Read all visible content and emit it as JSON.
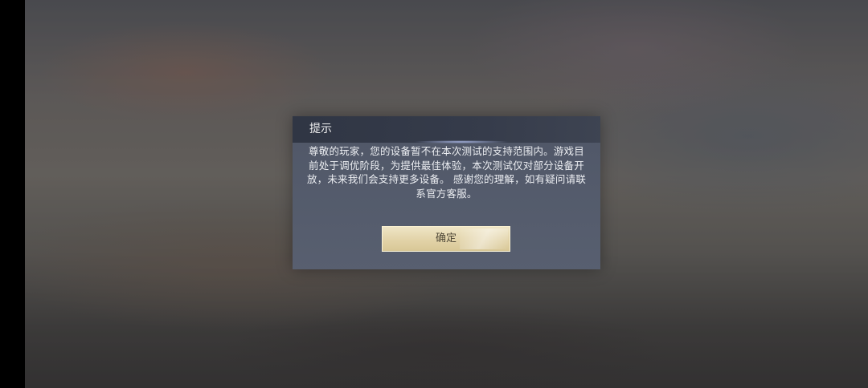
{
  "dialog": {
    "title": "提示",
    "message": "尊敬的玩家，您的设备暂不在本次测试的支持范围内。游戏目前处于调优阶段，为提供最佳体验，本次测试仅对部分设备开放，未来我们会支持更多设备。 感谢您的理解，如有疑问请联系官方客服。",
    "confirm_label": "确定"
  },
  "colors": {
    "dialog_bg": "#56607a",
    "header_bg": "#2f3545",
    "button_gold": "#e2d3a8",
    "button_text": "#4d4636"
  }
}
